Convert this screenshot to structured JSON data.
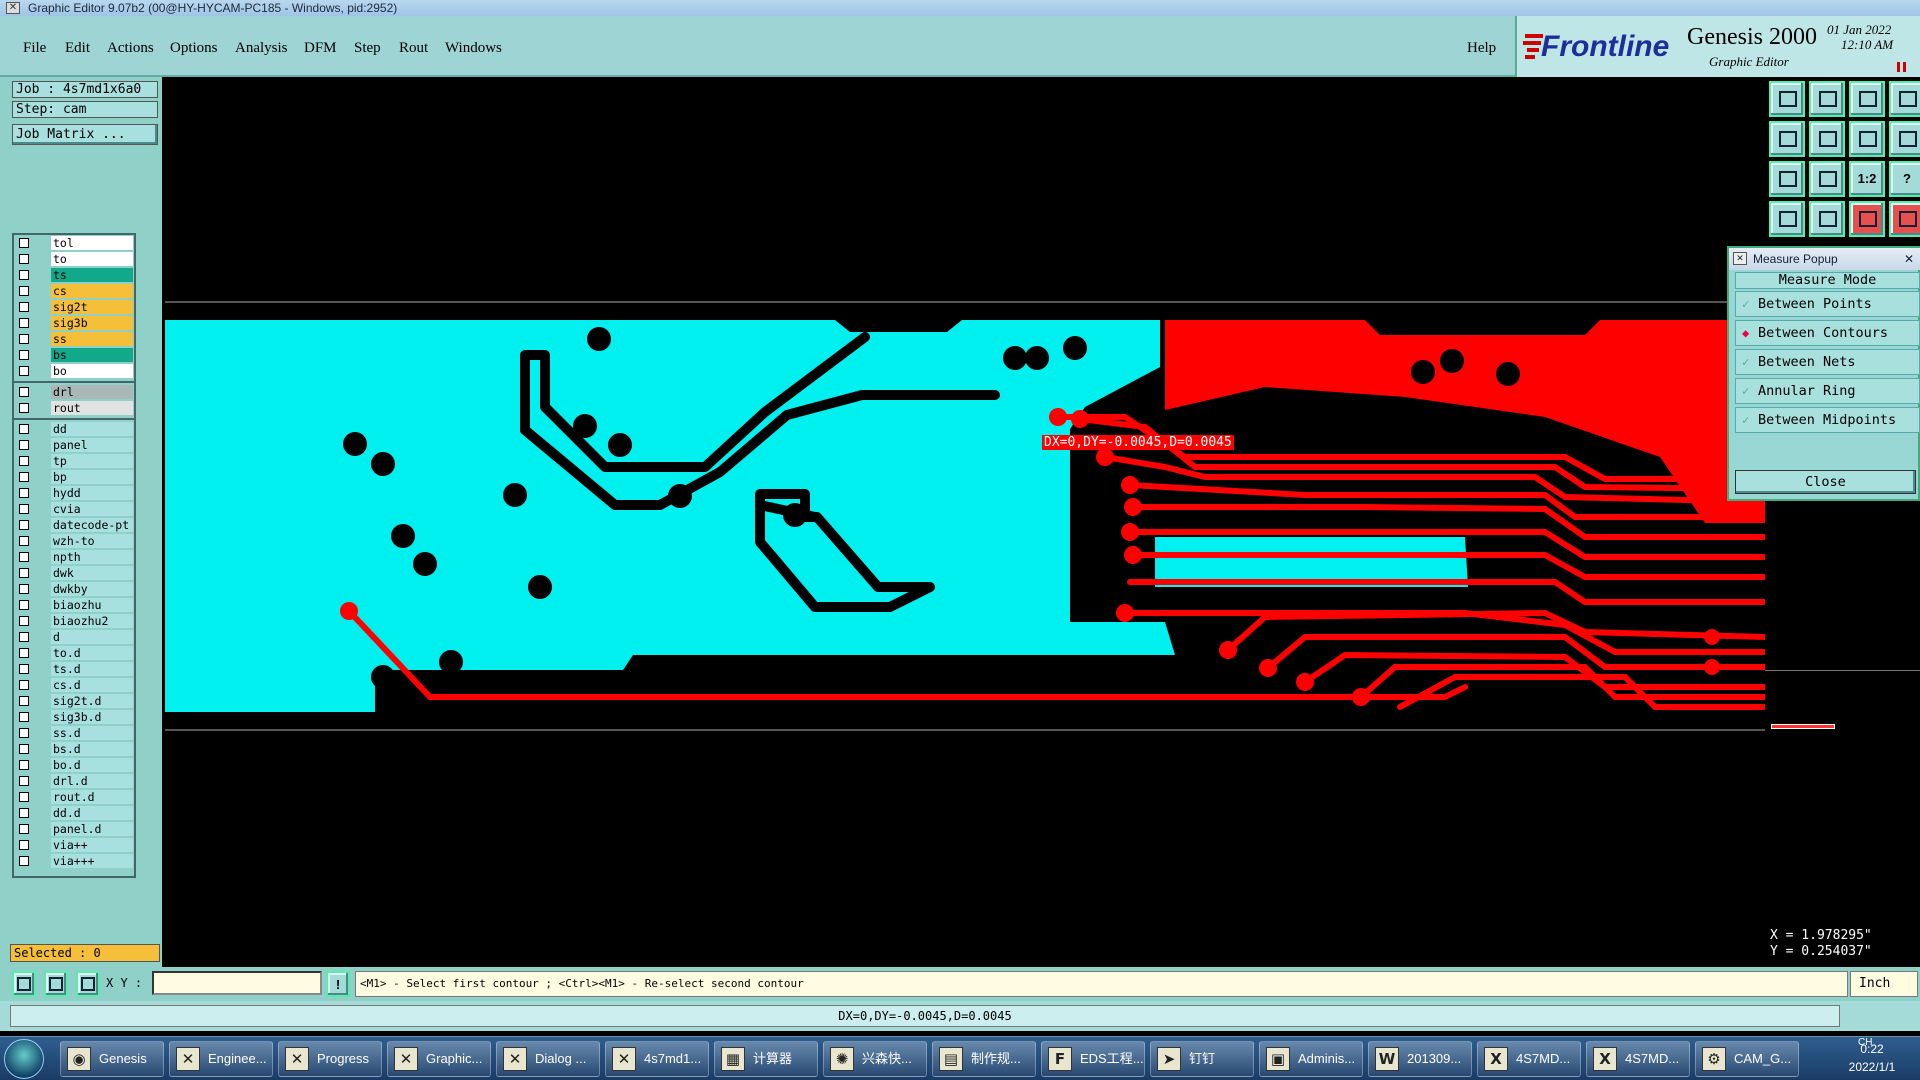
{
  "window": {
    "title": "Graphic Editor 9.07b2 (00@HY-HYCAM-PC185 - Windows, pid:2952)"
  },
  "menu": {
    "items": [
      "File",
      "Edit",
      "Actions",
      "Options",
      "Analysis",
      "DFM",
      "Step",
      "Rout",
      "Windows"
    ],
    "help": "Help"
  },
  "brand": {
    "logo": "Frontline",
    "product": "Genesis 2000",
    "subtitle": "Graphic Editor",
    "date": "01 Jan 2022",
    "time": "12:10 AM"
  },
  "job": {
    "job_label": "Job : 4s7md1x6a0",
    "step_label": "Step: cam",
    "matrix_button": "Job Matrix ..."
  },
  "layers": [
    {
      "name": "tol",
      "color": "#ffffff"
    },
    {
      "name": "to",
      "color": "#ffffff"
    },
    {
      "name": "ts",
      "color": "#12a88a"
    },
    {
      "name": "cs",
      "color": "#f5bf3a"
    },
    {
      "name": "sig2t",
      "color": "#f5bf3a"
    },
    {
      "name": "sig3b",
      "color": "#f5bf3a"
    },
    {
      "name": "ss",
      "color": "#f5bf3a"
    },
    {
      "name": "bs",
      "color": "#12a88a"
    },
    {
      "name": "bo",
      "color": "#ffffff"
    },
    {
      "name": "drl",
      "color": "#aab7b7"
    },
    {
      "name": "rout",
      "color": "#e2e2e2"
    },
    {
      "name": "dd",
      "color": "#a8e0e0"
    },
    {
      "name": "panel",
      "color": "#a8e0e0"
    },
    {
      "name": "tp",
      "color": "#a8e0e0"
    },
    {
      "name": "bp",
      "color": "#a8e0e0"
    },
    {
      "name": "hydd",
      "color": "#a8e0e0"
    },
    {
      "name": "cvia",
      "color": "#a8e0e0"
    },
    {
      "name": "datecode-pt",
      "color": "#a8e0e0"
    },
    {
      "name": "wzh-to",
      "color": "#a8e0e0"
    },
    {
      "name": "npth",
      "color": "#a8e0e0"
    },
    {
      "name": "dwk",
      "color": "#a8e0e0"
    },
    {
      "name": "dwkby",
      "color": "#a8e0e0"
    },
    {
      "name": "biaozhu",
      "color": "#a8e0e0"
    },
    {
      "name": "biaozhu2",
      "color": "#a8e0e0"
    },
    {
      "name": "d",
      "color": "#a8e0e0"
    },
    {
      "name": "to.d",
      "color": "#a8e0e0"
    },
    {
      "name": "ts.d",
      "color": "#a8e0e0"
    },
    {
      "name": "cs.d",
      "color": "#a8e0e0"
    },
    {
      "name": "sig2t.d",
      "color": "#a8e0e0"
    },
    {
      "name": "sig3b.d",
      "color": "#a8e0e0"
    },
    {
      "name": "ss.d",
      "color": "#a8e0e0"
    },
    {
      "name": "bs.d",
      "color": "#a8e0e0"
    },
    {
      "name": "bo.d",
      "color": "#a8e0e0"
    },
    {
      "name": "drl.d",
      "color": "#a8e0e0"
    },
    {
      "name": "rout.d",
      "color": "#a8e0e0"
    },
    {
      "name": "dd.d",
      "color": "#a8e0e0"
    },
    {
      "name": "panel.d",
      "color": "#a8e0e0"
    },
    {
      "name": "via++",
      "color": "#a8e0e0"
    },
    {
      "name": "via+++",
      "color": "#a8e0e0"
    }
  ],
  "selected": "Selected : 0",
  "measure": {
    "title": "Measure Popup",
    "mode_header": "Measure Mode",
    "options": [
      "Between Points",
      "Between Contours",
      "Between Nets",
      "Annular Ring",
      "Between Midpoints"
    ],
    "selected": "Between Contours",
    "close": "Close"
  },
  "canvas": {
    "measure_text": "DX=0,DY=-0.0045,D=0.0045",
    "cyan": "#00f0f0",
    "red": "#ff0000"
  },
  "coords": {
    "x": "X = 1.978295\"",
    "y": "Y = 0.254037\""
  },
  "command": {
    "xy_label": "X Y :",
    "prompt": "<M1> - Select first contour ; <Ctrl><M1> - Re-select second contour",
    "units": "Inch"
  },
  "status": "DX=0,DY=-0.0045,D=0.0045",
  "toolbar_text": {
    "scale": "1:2",
    "help": "?"
  },
  "taskbar": {
    "items": [
      "Genesis",
      "Enginee...",
      "Progress",
      "Graphic...",
      "Dialog ...",
      "4s7md1...",
      "计算器",
      "兴森快...",
      "制作规...",
      "EDS工程...",
      "钉钉",
      "Adminis...",
      "201309...",
      "4S7MD...",
      "4S7MD...",
      "CAM_G..."
    ],
    "lang": "CH",
    "time": "0:22",
    "date": "2022/1/1"
  }
}
